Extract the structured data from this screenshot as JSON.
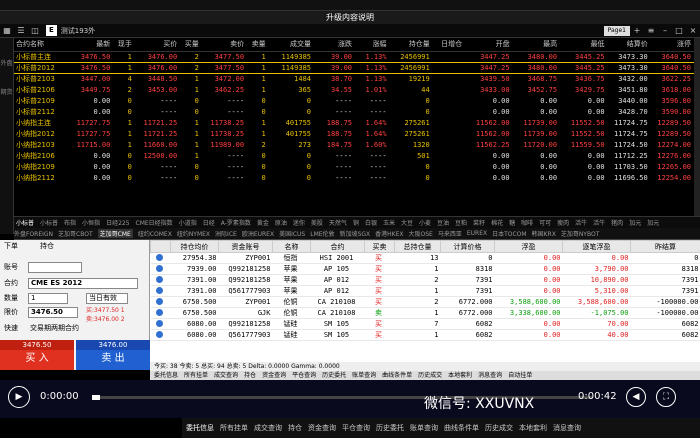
{
  "window": {
    "title": "升级内容说明"
  },
  "tabrow": {
    "page_button": "E",
    "page_name": "测试193外",
    "page_label": "Page1"
  },
  "side": {
    "label1": "外盘",
    "label2": "期货"
  },
  "quotes": {
    "headers": [
      "合约名称",
      "最新",
      "现手",
      "买价",
      "买量",
      "卖价",
      "卖量",
      "成交量",
      "涨跌",
      "涨幅",
      "持仓量",
      "日增仓",
      "开盘",
      "最高",
      "最低",
      "结算价",
      "涨停"
    ],
    "rows": [
      [
        "小标普主连",
        "3476.50",
        "1",
        "3476.00",
        "2",
        "3477.50",
        "1",
        "1149385",
        "39.00",
        "1.13%",
        "2456991",
        "",
        "3447.25",
        "3480.00",
        "3445.25",
        "3473.30",
        "3640.50"
      ],
      [
        "小标普2012",
        "3476.50",
        "1",
        "3476.00",
        "2",
        "3477.50",
        "1",
        "1149385",
        "39.00",
        "1.13%",
        "2456991",
        "",
        "3447.25",
        "3480.00",
        "3445.25",
        "3473.30",
        "3640.50"
      ],
      [
        "小标普2103",
        "3447.00",
        "4",
        "3448.50",
        "1",
        "3472.00",
        "1",
        "1484",
        "38.70",
        "1.13%",
        "19219",
        "",
        "3439.50",
        "3468.75",
        "3436.75",
        "3432.00",
        "3622.25"
      ],
      [
        "小标普2106",
        "3449.75",
        "2",
        "3453.00",
        "1",
        "3462.25",
        "1",
        "365",
        "34.55",
        "1.01%",
        "44",
        "",
        "3433.00",
        "3452.75",
        "3429.75",
        "3451.80",
        "3618.00"
      ],
      [
        "小标普2109",
        "0.00",
        "0",
        "----",
        "0",
        "----",
        "0",
        "0",
        "----",
        "----",
        "0",
        "",
        "0.00",
        "0.00",
        "0.00",
        "3440.00",
        "3596.00"
      ],
      [
        "小标普2112",
        "0.00",
        "0",
        "----",
        "0",
        "----",
        "0",
        "0",
        "----",
        "----",
        "0",
        "",
        "0.00",
        "0.00",
        "0.00",
        "3428.70",
        "3590.00"
      ],
      [
        "小纳指主连",
        "11727.75",
        "1",
        "11721.25",
        "1",
        "11738.25",
        "1",
        "401755",
        "188.75",
        "1.64%",
        "275261",
        "",
        "11562.00",
        "11739.00",
        "11552.50",
        "11724.75",
        "12289.50"
      ],
      [
        "小纳指2012",
        "11727.75",
        "1",
        "11721.25",
        "1",
        "11738.25",
        "1",
        "401755",
        "188.75",
        "1.64%",
        "275261",
        "",
        "11562.00",
        "11739.00",
        "11552.50",
        "11724.75",
        "12289.50"
      ],
      [
        "小纳指2103",
        "11715.00",
        "1",
        "11660.00",
        "1",
        "11989.00",
        "2",
        "273",
        "184.75",
        "1.60%",
        "1320",
        "",
        "11562.25",
        "11720.00",
        "11559.50",
        "11724.50",
        "12274.00"
      ],
      [
        "小纳指2106",
        "0.00",
        "0",
        "12500.00",
        "1",
        "----",
        "0",
        "0",
        "----",
        "----",
        "501",
        "",
        "0.00",
        "0.00",
        "0.00",
        "11712.25",
        "12276.00"
      ],
      [
        "小纳指2109",
        "0.00",
        "0",
        "----",
        "0",
        "----",
        "0",
        "0",
        "----",
        "----",
        "0",
        "",
        "0.00",
        "0.00",
        "0.00",
        "11703.50",
        "12265.00"
      ],
      [
        "小纳指2112",
        "0.00",
        "0",
        "----",
        "0",
        "----",
        "0",
        "0",
        "----",
        "----",
        "0",
        "",
        "0.00",
        "0.00",
        "0.00",
        "11696.50",
        "12254.00"
      ]
    ]
  },
  "subtabs": [
    "小标普",
    "小标普",
    "布指",
    "小恒指",
    "日经225",
    "CME日经指数",
    "小道指",
    "日经",
    "A-罗素指数",
    "黄金",
    "原油",
    "迷你",
    "美股",
    "天然气",
    "铜",
    "白银",
    "玉米",
    "大豆",
    "小麦",
    "豆油",
    "豆粕",
    "菜籽",
    "棉花",
    "糖",
    "咖啡",
    "可可",
    "瘦肉",
    "活牛",
    "活牛",
    "猪肉",
    "加元",
    "加元"
  ],
  "contracts": [
    "外盘FOREIGN",
    "芝加哥CBOT",
    "芝加哥CME",
    "纽约COMEX",
    "纽约NYMEX",
    "洲际ICE",
    "欧洲EUREX",
    "美国ICUS",
    "LME伦敦",
    "新加坡SGX",
    "香港HKEX",
    "大阪OSE",
    "马来西亚",
    "EUREX",
    "日本TOCOM",
    "韩国KRX",
    "芝加哥NYBOT"
  ],
  "order": {
    "header_left": "下单",
    "header_mid": "持仓",
    "account_label": "账号",
    "account_value": "",
    "contract_label": "合约",
    "contract_value": "CME ES 2012",
    "qty_label": "数量",
    "qty_value": "1",
    "validity": "当日有效",
    "price_label": "限价",
    "price_value": "3476.50",
    "bid_label": "买:3477.50  1",
    "ask_label": "卖:3476.00  2",
    "quick_label": "快速",
    "check_label": "交易期两期合约",
    "buy_price": "3476.50",
    "sell_price": "3476.00",
    "buy_label": "买 入",
    "sell_label": "卖 出"
  },
  "positions": {
    "headers": [
      "",
      "持仓均价",
      "资金账号",
      "名称",
      "合约",
      "买卖",
      "总持仓量",
      "计算价格",
      "浮盈",
      "逐笔浮盈",
      "昨结算"
    ],
    "rows": [
      [
        "",
        "27954.38",
        "ZYP001",
        "恒指",
        "HSI 2001",
        "买",
        "13",
        "0",
        "0.00",
        "0.00",
        "0"
      ],
      [
        "",
        "7939.00",
        "Q992181258",
        "苹果",
        "AP 105",
        "买",
        "1",
        "8318",
        "0.00",
        "3,790.00",
        "8318"
      ],
      [
        "",
        "7391.00",
        "Q992181258",
        "苹果",
        "AP 012",
        "买",
        "2",
        "7391",
        "0.00",
        "10,890.00",
        "7391"
      ],
      [
        "",
        "7391.00",
        "Q561777903",
        "苹果",
        "AP 012",
        "买",
        "1",
        "7391",
        "0.00",
        "5,310.00",
        "7391"
      ],
      [
        "",
        "6750.500",
        "ZYP001",
        "伦铜",
        "CA 210108",
        "买",
        "2",
        "6772.000",
        "3,588,600.00",
        "3,588,600.00",
        "-100000.00"
      ],
      [
        "",
        "6750.500",
        "GJK",
        "伦铜",
        "CA 210108",
        "卖",
        "1",
        "6772.000",
        "3,338,600.00",
        "-1,075.00",
        "-100000.00"
      ],
      [
        "",
        "6080.00",
        "Q992181258",
        "锰硅",
        "SM 105",
        "买",
        "7",
        "6082",
        "0.00",
        "70.00",
        "6082"
      ],
      [
        "",
        "6080.00",
        "Q561777903",
        "锰硅",
        "SM 105",
        "买",
        "1",
        "6082",
        "0.00",
        "40.00",
        "6082"
      ]
    ],
    "status": "今买: 38  今卖: 5   总买: 94   总卖: 5  Delta: 0.0000  Gamma: 0.0000"
  },
  "bottomtabs": [
    "委托信息",
    "所有挂单",
    "成交查询",
    "持仓",
    "资金查询",
    "平仓查询",
    "历史委托",
    "账单查询",
    "曲线条件单",
    "历史成交",
    "本地套利",
    "消息查询",
    "自动挂单"
  ],
  "video": {
    "time_current": "0:00:00",
    "time_end": "0:00:42",
    "wechat": "微信号: XXUVNX"
  },
  "footer": [
    "委托信息",
    "所有挂单",
    "成交查询",
    "持仓",
    "资金查询",
    "平仓查询",
    "历史委托",
    "账单查询",
    "曲线条件单",
    "历史成交",
    "本地套利",
    "消息查询"
  ]
}
